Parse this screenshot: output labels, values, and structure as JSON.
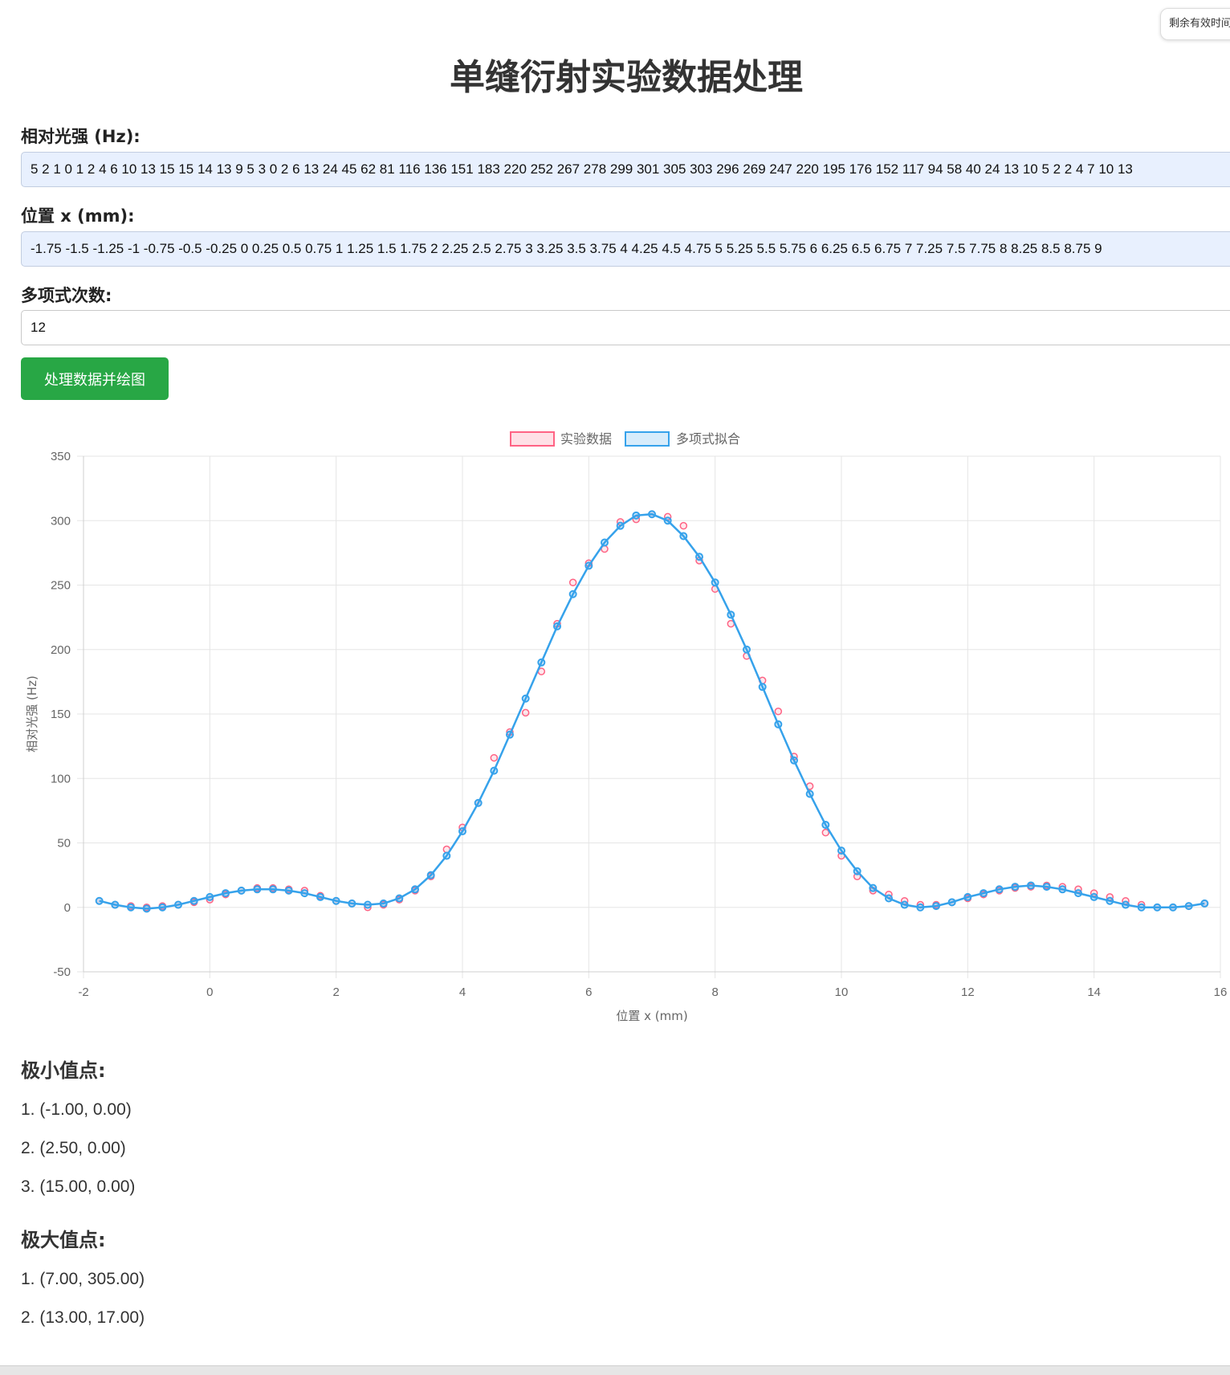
{
  "timer_text": "剩余有效时间",
  "page_title": "单缝衍射实验数据处理",
  "intensity": {
    "label": "相对光强 (Hz):",
    "value": "5 2 1 0 1 2 4 6 10 13 15 15 14 13 9 5 3 0 2 6 13 24 45 62 81 116 136 151 183 220 252 267 278 299 301 305 303 296 269 247 220 195 176 152 117 94 58 40 24 13 10 5 2 2 4 7 10 13"
  },
  "position": {
    "label": "位置 x (mm):",
    "value": "-1.75 -1.5 -1.25 -1 -0.75 -0.5 -0.25 0 0.25 0.5 0.75 1 1.25 1.5 1.75 2 2.25 2.5 2.75 3 3.25 3.5 3.75 4 4.25 4.5 4.75 5 5.25 5.5 5.75 6 6.25 6.5 6.75 7 7.25      7.5   7.75 8 8.25 8.5 8.75 9"
  },
  "degree": {
    "label": "多项式次数:",
    "value": "12"
  },
  "run_button_label": "处理数据并绘图",
  "chart_data": {
    "type": "scatter",
    "xlabel": "位置 x (mm)",
    "ylabel": "相对光强 (Hz)",
    "xlim": [
      -2,
      16
    ],
    "ylim": [
      -50,
      350
    ],
    "x_ticks": [
      -2,
      0,
      2,
      4,
      6,
      8,
      10,
      12,
      14,
      16
    ],
    "y_ticks": [
      -50,
      0,
      50,
      100,
      150,
      200,
      250,
      300,
      350
    ],
    "grid": true,
    "legend_position": "top-center",
    "series": [
      {
        "name": "实验数据",
        "kind": "scatter",
        "color": "#ff6384",
        "x": [
          -1.75,
          -1.5,
          -1.25,
          -1,
          -0.75,
          -0.5,
          -0.25,
          0,
          0.25,
          0.5,
          0.75,
          1,
          1.25,
          1.5,
          1.75,
          2,
          2.25,
          2.5,
          2.75,
          3,
          3.25,
          3.5,
          3.75,
          4,
          4.25,
          4.5,
          4.75,
          5,
          5.25,
          5.5,
          5.75,
          6,
          6.25,
          6.5,
          6.75,
          7,
          7.25,
          7.5,
          7.75,
          8,
          8.25,
          8.5,
          8.75,
          9,
          9.25,
          9.5,
          9.75,
          10,
          10.25,
          10.5,
          10.75,
          11,
          11.25,
          11.5,
          11.75,
          12,
          12.25,
          12.5,
          12.75,
          13,
          13.25,
          13.5,
          13.75,
          14,
          14.25,
          14.5,
          14.75,
          15,
          15.25,
          15.5,
          15.75
        ],
        "y": [
          5,
          2,
          1,
          0,
          1,
          2,
          4,
          6,
          10,
          13,
          15,
          15,
          14,
          13,
          9,
          5,
          3,
          0,
          2,
          6,
          13,
          24,
          45,
          62,
          81,
          116,
          136,
          151,
          183,
          220,
          252,
          267,
          278,
          299,
          301,
          305,
          303,
          296,
          269,
          247,
          220,
          195,
          176,
          152,
          117,
          94,
          58,
          40,
          24,
          13,
          10,
          5,
          2,
          2,
          4,
          7,
          10,
          13,
          15,
          16,
          17,
          16,
          14,
          11,
          8,
          5,
          2,
          0,
          0,
          1,
          3
        ]
      },
      {
        "name": "多项式拟合",
        "kind": "line",
        "color": "#36a2eb",
        "x": [
          -1.75,
          -1.5,
          -1.25,
          -1,
          -0.75,
          -0.5,
          -0.25,
          0,
          0.25,
          0.5,
          0.75,
          1,
          1.25,
          1.5,
          1.75,
          2,
          2.25,
          2.5,
          2.75,
          3,
          3.25,
          3.5,
          3.75,
          4,
          4.25,
          4.5,
          4.75,
          5,
          5.25,
          5.5,
          5.75,
          6,
          6.25,
          6.5,
          6.75,
          7,
          7.25,
          7.5,
          7.75,
          8,
          8.25,
          8.5,
          8.75,
          9,
          9.25,
          9.5,
          9.75,
          10,
          10.25,
          10.5,
          10.75,
          11,
          11.25,
          11.5,
          11.75,
          12,
          12.25,
          12.5,
          12.75,
          13,
          13.25,
          13.5,
          13.75,
          14,
          14.25,
          14.5,
          14.75,
          15,
          15.25,
          15.5,
          15.75
        ],
        "y": [
          5,
          2,
          0,
          -1,
          0,
          2,
          5,
          8,
          11,
          13,
          14,
          14,
          13,
          11,
          8,
          5,
          3,
          2,
          3,
          7,
          14,
          25,
          40,
          59,
          81,
          106,
          134,
          162,
          190,
          218,
          243,
          265,
          283,
          296,
          304,
          305,
          300,
          288,
          272,
          252,
          227,
          200,
          171,
          142,
          114,
          88,
          64,
          44,
          28,
          15,
          7,
          2,
          0,
          1,
          4,
          8,
          11,
          14,
          16,
          17,
          16,
          14,
          11,
          8,
          5,
          2,
          0,
          0,
          0,
          1,
          3
        ]
      }
    ]
  },
  "minima": {
    "title": "极小值点:",
    "items": [
      "1. (-1.00, 0.00)",
      "2. (2.50, 0.00)",
      "3. (15.00, 0.00)"
    ]
  },
  "maxima": {
    "title": "极大值点:",
    "items": [
      "1. (7.00, 305.00)",
      "2. (13.00, 17.00)"
    ]
  }
}
